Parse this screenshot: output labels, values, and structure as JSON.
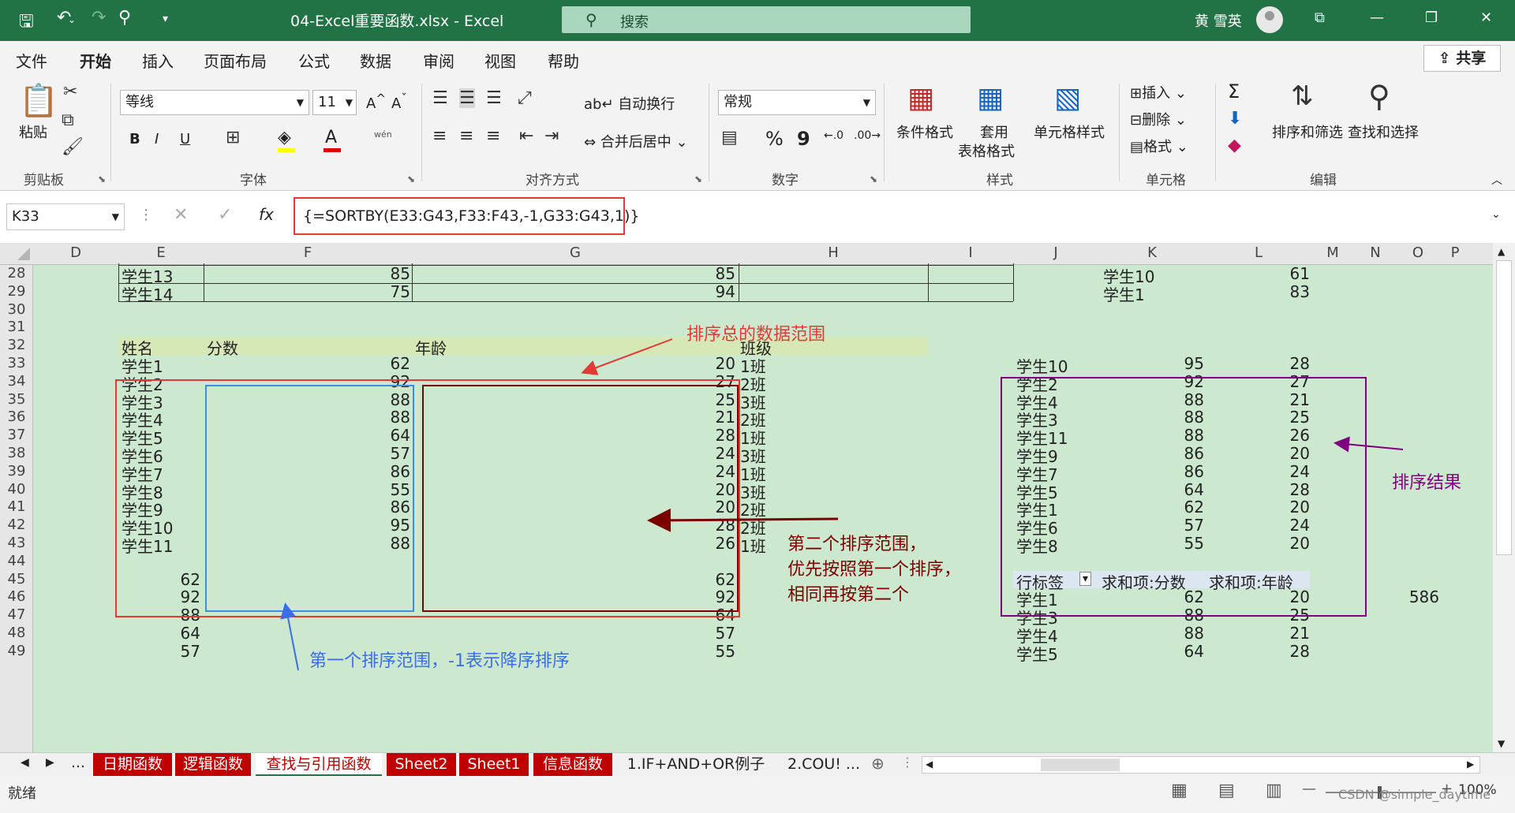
{
  "titlebar": {
    "title": "04-Excel重要函数.xlsx  -  Excel",
    "search_placeholder": "搜索",
    "user": "黄 雪英",
    "undo_icon": "undo-icon",
    "redo_icon": "redo-icon"
  },
  "menu": [
    "文件",
    "开始",
    "插入",
    "页面布局",
    "公式",
    "数据",
    "审阅",
    "视图",
    "帮助"
  ],
  "share_label": "共享",
  "ribbon": {
    "paste": "粘贴",
    "font_name": "等线",
    "font_size": "11",
    "wrap": "自动换行",
    "merge": "合并后居中",
    "number_format": "常规",
    "cond_format": "条件格式",
    "table_format_1": "套用",
    "table_format_2": "表格格式",
    "cell_style": "单元格样式",
    "insert": "插入",
    "delete": "删除",
    "format": "格式",
    "sort_filter": "排序和筛选",
    "find_select": "查找和选择",
    "groups": [
      "剪贴板",
      "字体",
      "对齐方式",
      "数字",
      "样式",
      "单元格",
      "编辑"
    ],
    "bold": "B",
    "italic": "I",
    "underline": "U",
    "percent": "%",
    "comma": "9",
    "sigma": "Σ",
    "wen": "wén"
  },
  "formula_bar": {
    "name_box": "K33",
    "formula": "{=SORTBY(E33:G43,F33:F43,-1,G33:G43,1)}"
  },
  "columns": [
    "D",
    "E",
    "F",
    "G",
    "H",
    "I",
    "J",
    "K",
    "L",
    "M",
    "N",
    "O",
    "P"
  ],
  "rows": [
    "28",
    "29",
    "30",
    "31",
    "32",
    "33",
    "34",
    "35",
    "36",
    "37",
    "38",
    "39",
    "40",
    "41",
    "42",
    "43",
    "44",
    "45",
    "46",
    "47",
    "48",
    "49"
  ],
  "top_rows": [
    {
      "name": "学生13",
      "score": "85",
      "age": "85",
      "k": "学生10",
      "l": "61"
    },
    {
      "name": "学生14",
      "score": "75",
      "age": "94",
      "k": "学生1",
      "l": "83"
    }
  ],
  "table_header": {
    "name": "姓名",
    "score": "分数",
    "age": "年龄",
    "class": "班级"
  },
  "source_table": [
    {
      "name": "学生1",
      "score": "62",
      "age": "20",
      "class": "1班"
    },
    {
      "name": "学生2",
      "score": "92",
      "age": "27",
      "class": "2班"
    },
    {
      "name": "学生3",
      "score": "88",
      "age": "25",
      "class": "3班"
    },
    {
      "name": "学生4",
      "score": "88",
      "age": "21",
      "class": "2班"
    },
    {
      "name": "学生5",
      "score": "64",
      "age": "28",
      "class": "1班"
    },
    {
      "name": "学生6",
      "score": "57",
      "age": "24",
      "class": "3班"
    },
    {
      "name": "学生7",
      "score": "86",
      "age": "24",
      "class": "1班"
    },
    {
      "name": "学生8",
      "score": "55",
      "age": "20",
      "class": "3班"
    },
    {
      "name": "学生9",
      "score": "86",
      "age": "20",
      "class": "2班"
    },
    {
      "name": "学生10",
      "score": "95",
      "age": "28",
      "class": "2班"
    },
    {
      "name": "学生11",
      "score": "88",
      "age": "26",
      "class": "1班"
    }
  ],
  "result_table": [
    {
      "name": "学生10",
      "score": "95",
      "age": "28"
    },
    {
      "name": "学生2",
      "score": "92",
      "age": "27"
    },
    {
      "name": "学生4",
      "score": "88",
      "age": "21"
    },
    {
      "name": "学生3",
      "score": "88",
      "age": "25"
    },
    {
      "name": "学生11",
      "score": "88",
      "age": "26"
    },
    {
      "name": "学生9",
      "score": "86",
      "age": "20"
    },
    {
      "name": "学生7",
      "score": "86",
      "age": "24"
    },
    {
      "name": "学生5",
      "score": "64",
      "age": "28"
    },
    {
      "name": "学生1",
      "score": "62",
      "age": "20"
    },
    {
      "name": "学生6",
      "score": "57",
      "age": "24"
    },
    {
      "name": "学生8",
      "score": "55",
      "age": "20"
    }
  ],
  "lower_rows": [
    {
      "e": "62",
      "g": "62"
    },
    {
      "e": "92",
      "g": "92"
    },
    {
      "e": "88",
      "g": "64"
    },
    {
      "e": "64",
      "g": "57"
    },
    {
      "e": "57",
      "g": "55"
    }
  ],
  "pivot": {
    "h1": "行标签",
    "h2": "求和项:分数",
    "h3": "求和项:年龄",
    "rows": [
      {
        "name": "学生1",
        "score": "62",
        "age": "20"
      },
      {
        "name": "学生3",
        "score": "88",
        "age": "25"
      },
      {
        "name": "学生4",
        "score": "88",
        "age": "21"
      },
      {
        "name": "学生5",
        "score": "64",
        "age": "28"
      }
    ],
    "extra": "586"
  },
  "annotations": {
    "total_range": "排序总的数据范围",
    "first_range": "第一个排序范围，-1表示降序排序",
    "second_1": "第二个排序范围，",
    "second_2": "优先按照第一个排序，",
    "second_3": "相同再按第二个",
    "result": "排序结果"
  },
  "sheet_tabs": [
    "日期函数",
    "逻辑函数",
    "查找与引用函数",
    "Sheet2",
    "Sheet1",
    "信息函数",
    "1.IF+AND+OR例子",
    "2.COU! ..."
  ],
  "status": "就绪",
  "zoom": "100%",
  "watermark": "CSDN @simple_daytime",
  "colors": {
    "excel_green": "#217346",
    "grid_bg": "#cce8cf",
    "red_box": "#e53935",
    "blue_box": "#3a8ee6",
    "darkred_box": "#7b0000",
    "purple_box": "#800080"
  }
}
